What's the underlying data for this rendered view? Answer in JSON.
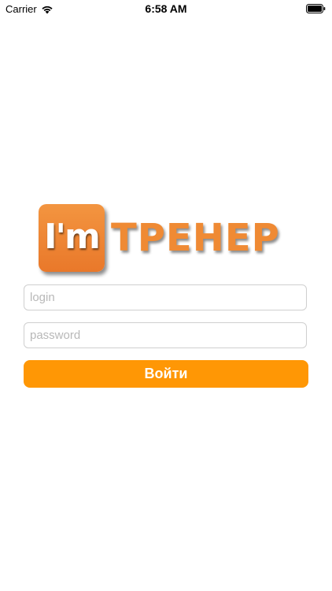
{
  "status_bar": {
    "carrier": "Carrier",
    "time": "6:58 AM",
    "icons": [
      "wifi-icon",
      "battery-icon"
    ]
  },
  "logo": {
    "badge_text": "I'm",
    "word": "ТРЕНЕР"
  },
  "form": {
    "login_placeholder": "login",
    "login_value": "",
    "password_placeholder": "password",
    "password_value": "",
    "submit_label": "Войти"
  },
  "colors": {
    "accent": "#ff9705",
    "logo_orange": "#ef8a34",
    "field_border": "#cfcfcf",
    "placeholder": "#b8b8b8",
    "background": "#ffffff"
  }
}
